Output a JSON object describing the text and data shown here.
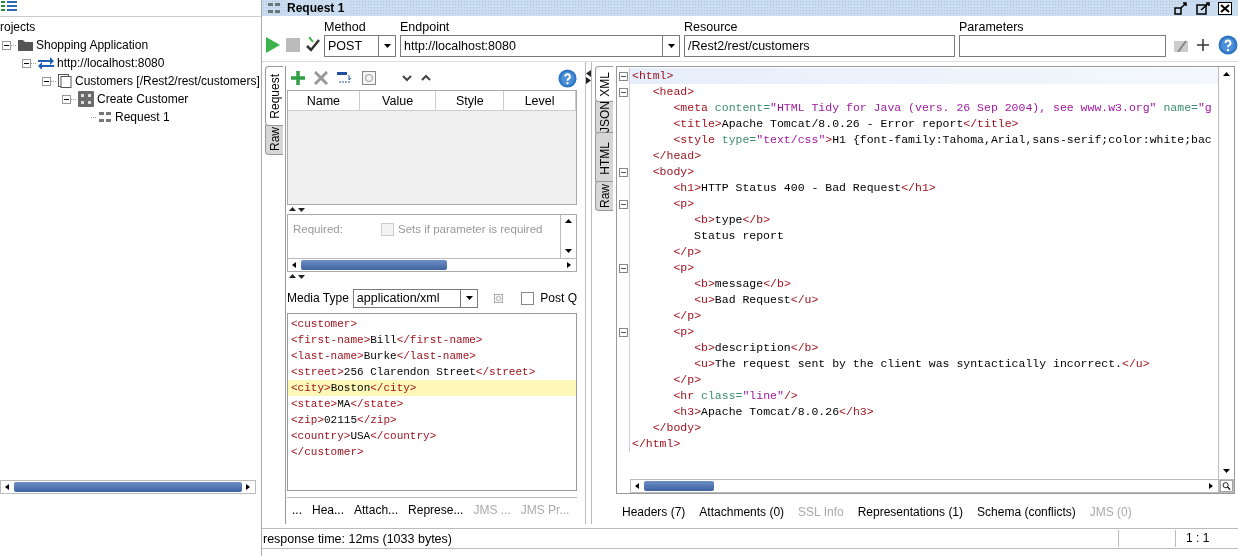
{
  "navigator": {
    "title": "rojects",
    "tree": [
      {
        "label": "Shopping Application",
        "kind": "folder",
        "expanded": true,
        "children": [
          {
            "label": "http://localhost:8080",
            "kind": "service",
            "expanded": true,
            "children": [
              {
                "label": "Customers [/Rest2/rest/customers]",
                "kind": "resource",
                "expanded": true,
                "children": [
                  {
                    "label": "Create Customer",
                    "kind": "method",
                    "expanded": true,
                    "children": [
                      {
                        "label": "Request 1",
                        "kind": "request"
                      }
                    ]
                  }
                ]
              }
            ]
          }
        ]
      }
    ]
  },
  "request_window": {
    "title": "Request 1",
    "method": {
      "label": "Method",
      "value": "POST"
    },
    "endpoint": {
      "label": "Endpoint",
      "value": "http://localhost:8080"
    },
    "resource": {
      "label": "Resource",
      "value": "/Rest2/rest/customers"
    },
    "parameters": {
      "label": "Parameters"
    }
  },
  "request_panel": {
    "side_tabs": [
      {
        "label": "Request",
        "selected": true
      },
      {
        "label": "Raw",
        "selected": false
      }
    ],
    "params_table": {
      "columns": [
        "Name",
        "Value",
        "Style",
        "Level"
      ]
    },
    "required_label": "Required:",
    "required_checkbox": {
      "label": "Sets if parameter is required",
      "checked": false,
      "disabled": true
    },
    "media_type": {
      "label": "Media Type",
      "value": "application/xml"
    },
    "post_checkbox": {
      "label": "Post Q",
      "checked": false
    },
    "body_lines": [
      {
        "text": "<customer>",
        "highlighted": false
      },
      {
        "text": "<first-name>Bill</first-name>",
        "highlighted": false
      },
      {
        "text": "<last-name>Burke</last-name>",
        "highlighted": false
      },
      {
        "text": "<street>256 Clarendon Street</street>",
        "highlighted": false
      },
      {
        "text": "<city>Boston</city>",
        "highlighted": true
      },
      {
        "text": "<state>MA</state>",
        "highlighted": false
      },
      {
        "text": "<zip>02115</zip>",
        "highlighted": false
      },
      {
        "text": "<country>USA</country>",
        "highlighted": false
      },
      {
        "text": "</customer>",
        "highlighted": false
      }
    ],
    "bottom_tabs": [
      {
        "label": "...",
        "disabled": false
      },
      {
        "label": "Hea...",
        "disabled": false
      },
      {
        "label": "Attach...",
        "disabled": false
      },
      {
        "label": "Represe...",
        "disabled": false
      },
      {
        "label": "JMS ...",
        "disabled": true
      },
      {
        "label": "JMS Pr...",
        "disabled": true
      }
    ]
  },
  "response_panel": {
    "side_tabs": [
      {
        "label": "XML",
        "selected": true
      },
      {
        "label": "JSON",
        "selected": false
      },
      {
        "label": "HTML",
        "selected": false
      },
      {
        "label": "Raw",
        "selected": false
      }
    ],
    "lines": [
      {
        "text": "<html>",
        "foldable": true,
        "current": true
      },
      {
        "text": "   <head>",
        "foldable": true,
        "current": false
      },
      {
        "text": "      <meta content=\"HTML Tidy for Java (vers. 26 Sep 2004), see www.w3.org\" name=\"g",
        "foldable": false,
        "current": false
      },
      {
        "text": "      <title>Apache Tomcat/8.0.26 - Error report</title>",
        "foldable": false,
        "current": false
      },
      {
        "text": "      <style type=\"text/css\">H1 {font-family:Tahoma,Arial,sans-serif;color:white;bac",
        "foldable": false,
        "current": false
      },
      {
        "text": "   </head>",
        "foldable": false,
        "current": false
      },
      {
        "text": "   <body>",
        "foldable": true,
        "current": false
      },
      {
        "text": "      <h1>HTTP Status 400 - Bad Request</h1>",
        "foldable": false,
        "current": false
      },
      {
        "text": "      <p>",
        "foldable": true,
        "current": false
      },
      {
        "text": "         <b>type</b>",
        "foldable": false,
        "current": false
      },
      {
        "text": "         Status report",
        "foldable": false,
        "current": false
      },
      {
        "text": "      </p>",
        "foldable": false,
        "current": false
      },
      {
        "text": "      <p>",
        "foldable": true,
        "current": false
      },
      {
        "text": "         <b>message</b>",
        "foldable": false,
        "current": false
      },
      {
        "text": "         <u>Bad Request</u>",
        "foldable": false,
        "current": false
      },
      {
        "text": "      </p>",
        "foldable": false,
        "current": false
      },
      {
        "text": "      <p>",
        "foldable": true,
        "current": false
      },
      {
        "text": "         <b>description</b>",
        "foldable": false,
        "current": false
      },
      {
        "text": "         <u>The request sent by the client was syntactically incorrect.</u>",
        "foldable": false,
        "current": false
      },
      {
        "text": "      </p>",
        "foldable": false,
        "current": false
      },
      {
        "text": "      <hr class=\"line\"/>",
        "foldable": false,
        "current": false
      },
      {
        "text": "      <h3>Apache Tomcat/8.0.26</h3>",
        "foldable": false,
        "current": false
      },
      {
        "text": "   </body>",
        "foldable": false,
        "current": false
      },
      {
        "text": "</html>",
        "foldable": false,
        "current": false
      }
    ],
    "bottom_tabs": [
      {
        "label": "Headers (7)",
        "disabled": false
      },
      {
        "label": "Attachments (0)",
        "disabled": false
      },
      {
        "label": "SSL Info",
        "disabled": true
      },
      {
        "label": "Representations (1)",
        "disabled": false
      },
      {
        "label": "Schema (conflicts)",
        "disabled": false
      },
      {
        "label": "JMS (0)",
        "disabled": true
      }
    ]
  },
  "status_bar": {
    "text": "response time: 12ms (1033 bytes)",
    "position": "1 : 1"
  }
}
